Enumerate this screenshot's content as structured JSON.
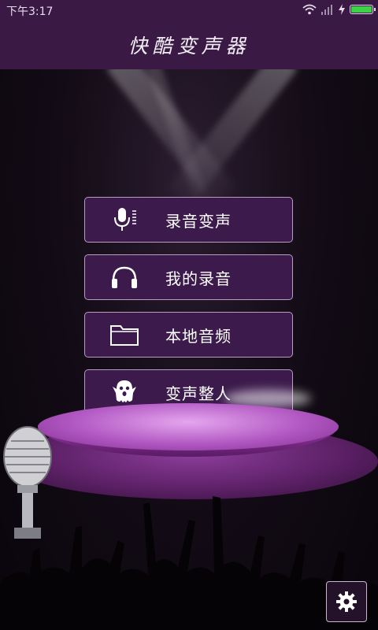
{
  "status_bar": {
    "time": "下午3:17"
  },
  "header": {
    "title": "快酷变声器"
  },
  "menu": [
    {
      "label": "录音变声",
      "icon": "microphone-icon"
    },
    {
      "label": "我的录音",
      "icon": "headphones-icon"
    },
    {
      "label": "本地音频",
      "icon": "folder-icon"
    },
    {
      "label": "变声整人",
      "icon": "ghost-icon"
    }
  ],
  "settings": {
    "icon": "gear-icon"
  },
  "colors": {
    "header_bg": "#3a1a45",
    "menu_bg": "#3c1a4c",
    "menu_border": "#b79cc4",
    "battery": "#3fd14a"
  }
}
